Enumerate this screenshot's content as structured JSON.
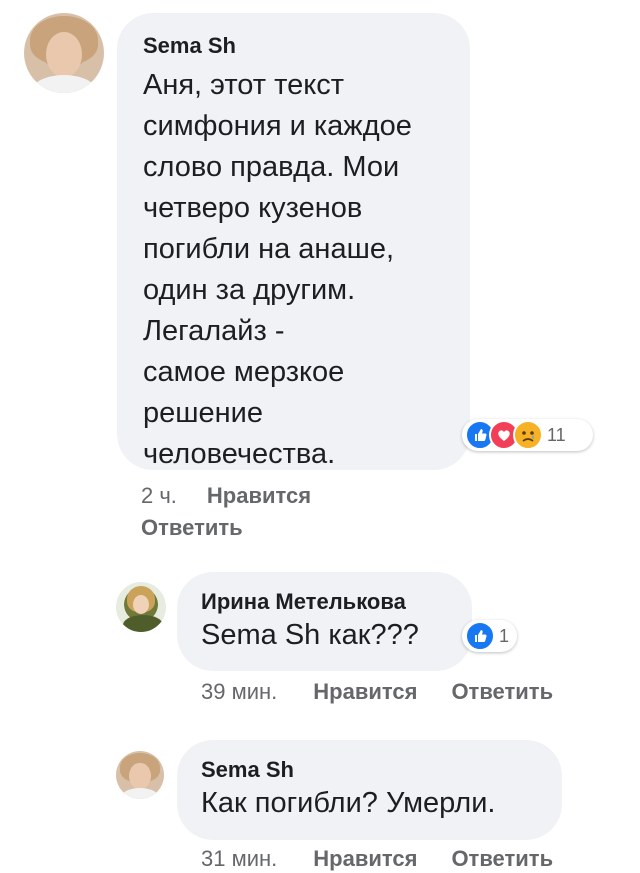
{
  "comments": [
    {
      "author": "Sema Sh",
      "text_lines": [
        "Аня, этот текст",
        "симфония и каждое",
        "слово правда. Мои",
        "четверо кузенов",
        "погибли на анаше,",
        "один за другим.",
        "Легалайз -",
        "самое мерзкое",
        "решение",
        "человечества."
      ],
      "reactions": [
        "like",
        "love",
        "sad"
      ],
      "reaction_count": "11",
      "time": "2 ч.",
      "like_label": "Нравится",
      "reply_label": "Ответить"
    },
    {
      "author": "Ирина Метелькова",
      "text": "Sema Sh как???",
      "reactions": [
        "like"
      ],
      "reaction_count": "1",
      "time": "39 мин.",
      "like_label": "Нравится",
      "reply_label": "Ответить"
    },
    {
      "author": "Sema Sh",
      "text": "Как погибли? Умерли.",
      "time": "31 мин.",
      "like_label": "Нравится",
      "reply_label": "Ответить"
    }
  ],
  "colors": {
    "like": "#1877f2",
    "love": "#f33e58",
    "sad": "#f7b125",
    "bubble": "#f0f2f5",
    "meta": "#65676b"
  }
}
